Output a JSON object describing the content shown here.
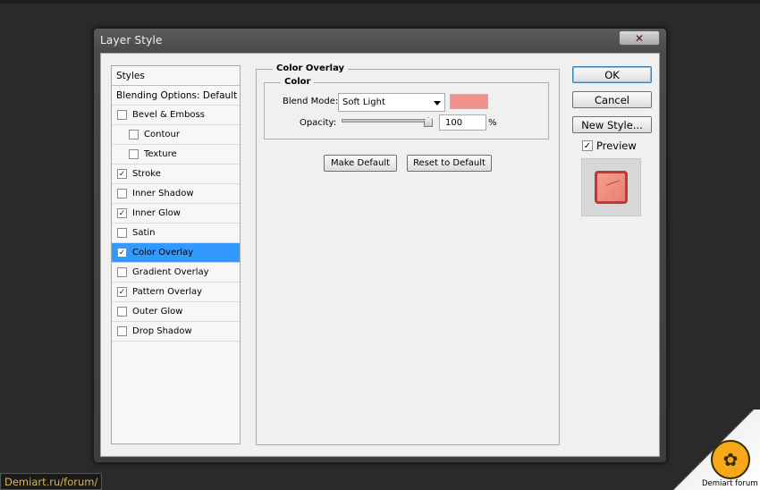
{
  "window": {
    "title": "Layer Style",
    "close_glyph": "✕"
  },
  "styles_list": {
    "header": "Styles",
    "blending": "Blending Options: Default",
    "items": [
      {
        "label": "Bevel & Emboss",
        "checked": false,
        "level": 1
      },
      {
        "label": "Contour",
        "checked": false,
        "level": 2
      },
      {
        "label": "Texture",
        "checked": false,
        "level": 2
      },
      {
        "label": "Stroke",
        "checked": true,
        "level": 1
      },
      {
        "label": "Inner Shadow",
        "checked": false,
        "level": 1
      },
      {
        "label": "Inner Glow",
        "checked": true,
        "level": 1
      },
      {
        "label": "Satin",
        "checked": false,
        "level": 1
      },
      {
        "label": "Color Overlay",
        "checked": true,
        "level": 1,
        "selected": true
      },
      {
        "label": "Gradient Overlay",
        "checked": false,
        "level": 1
      },
      {
        "label": "Pattern Overlay",
        "checked": true,
        "level": 1
      },
      {
        "label": "Outer Glow",
        "checked": false,
        "level": 1
      },
      {
        "label": "Drop Shadow",
        "checked": false,
        "level": 1
      }
    ]
  },
  "color_overlay": {
    "title": "Color Overlay",
    "group_title": "Color",
    "blend_mode_label": "Blend Mode:",
    "blend_mode_value": "Soft Light",
    "swatch_color": "#f0908c",
    "opacity_label": "Opacity:",
    "opacity_value": "100",
    "opacity_percent": 100,
    "opacity_unit": "%",
    "make_default": "Make Default",
    "reset_default": "Reset to Default"
  },
  "actions": {
    "ok": "OK",
    "cancel": "Cancel",
    "new_style": "New Style...",
    "preview_label": "Preview",
    "preview_checked": true
  },
  "watermark": {
    "url": "Demiart.ru/forum/",
    "logo_text": "Demiart forum"
  },
  "colors": {
    "selection": "#3399ff",
    "overlay_swatch": "#f0908c",
    "watermark": "#d8b656"
  }
}
